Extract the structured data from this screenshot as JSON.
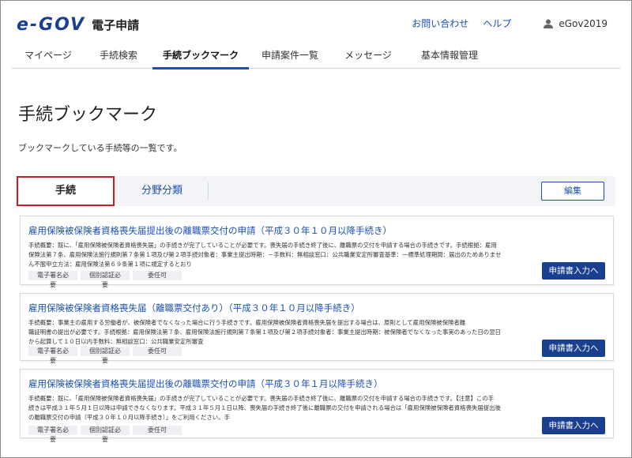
{
  "header": {
    "logo_mark": "e-GOV",
    "logo_sub": "電子申請",
    "links": [
      "お問い合わせ",
      "ヘルプ"
    ],
    "user_name": "eGov2019"
  },
  "nav": {
    "items": [
      "マイページ",
      "手続検索",
      "手続ブックマーク",
      "申請案件一覧",
      "メッセージ",
      "基本情報管理"
    ],
    "active_index": 2
  },
  "page": {
    "title": "手続ブックマーク",
    "description": "ブックマークしている手続等の一覧です。"
  },
  "tabs": {
    "items": [
      "手続",
      "分野分類"
    ],
    "edit_label": "編集"
  },
  "cards": [
    {
      "title": "雇用保険被保険者資格喪失届提出後の離職票交付の申請（平成３０年１０月以降手続き）",
      "lines": [
        "手続概要：既に、「雇用保険被保険者資格喪失届」の手続きが完了していることが必要です。喪失届の手続き終了後に、離職票の交付を申請する場合の手続きです。手続根拠：雇用",
        "保険法第７条、雇用保険法施行規則第７条第１項及び第２項手続対象者：事業主提出時期：－手数料：無相談窓口：公共職業安定所審査基準：一標準処理期間：届出のためありませ",
        "ん不服申立方法：雇用保険法第６９条第１項に規定するとおり"
      ],
      "tags": [
        "電子署名必要",
        "個別認証必要",
        "委任可"
      ],
      "button": "申請書入力へ"
    },
    {
      "title": "雇用保険被保険者資格喪失届（離職票交付あり）（平成３０年１０月以降手続き）",
      "lines": [
        "手続概要：事業主の雇用する労働者が、被保険者でなくなった場合に行う手続きです。雇用保険被保険者資格喪失届を提出する場合は、原則として雇用保険被保険者離",
        "職証明書の提出が必要です。手続根拠：雇用保険法第７条、雇用保険法施行規則第７条第１項及び第２項手続対象者：事業主提出時期：被保険者でなくなった事実のあった日の翌日",
        "から起算して１０日以内手数料：無相談窓口：公共職業安定所審査"
      ],
      "tags": [
        "電子署名必要",
        "個別認証必要",
        "委任可"
      ],
      "button": "申請書入力へ"
    },
    {
      "title": "雇用保険被保険者資格喪失届提出後の離職票交付の申請（平成３０年１月以降手続き）",
      "lines": [
        "手続概要：既に、「雇用保険被保険者資格喪失届」の手続きが完了していることが必要です。喪失届の手続き終了後に、離職票の交付を申請する場合の手続きです。【注意】この手",
        "続きは平成３１年５月１日以降は申請できなくなります。平成３１年５月１日以降、喪失届の手続き終了後に離職票の交付を申請される場合は「雇用保険被保険者資格喪失届提出後",
        "の離職票交付の申請（平成３０年１０月以降手続き）」をご利用ください。手"
      ],
      "tags": [
        "電子署名必要",
        "個別認証必要",
        "委任可"
      ],
      "button": "申請書入力へ"
    }
  ],
  "colors": {
    "brand": "#1a3f8f",
    "link": "#1a4fb4",
    "active_tab_border": "#c0202a",
    "tab_bar_bg": "#f2f4f7"
  }
}
